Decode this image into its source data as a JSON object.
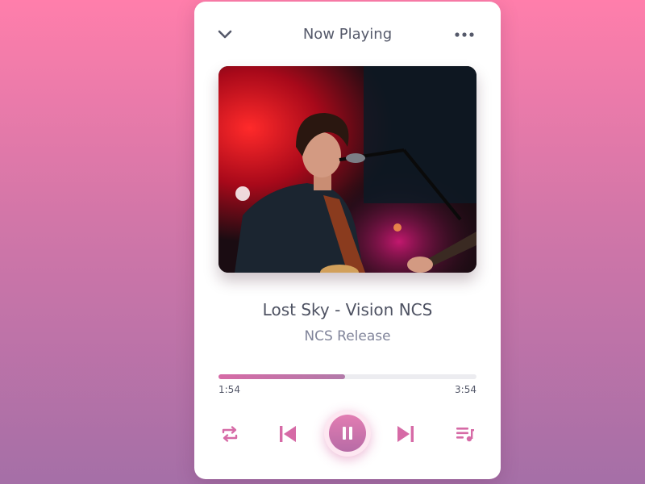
{
  "header": {
    "title": "Now Playing"
  },
  "track": {
    "title": "Lost Sky - Vision NCS",
    "artist": "NCS Release"
  },
  "progress": {
    "current": "1:54",
    "total": "3:54",
    "fraction": 0.49
  },
  "icons": {
    "collapse": "chevron-down-icon",
    "more": "more-horizontal-icon",
    "repeat": "repeat-icon",
    "previous": "skip-previous-icon",
    "pause": "pause-icon",
    "next": "skip-next-icon",
    "queue": "playlist-icon"
  },
  "colors": {
    "accent": "#d66aa6",
    "text": "#4e5262",
    "muted": "#80849a"
  }
}
